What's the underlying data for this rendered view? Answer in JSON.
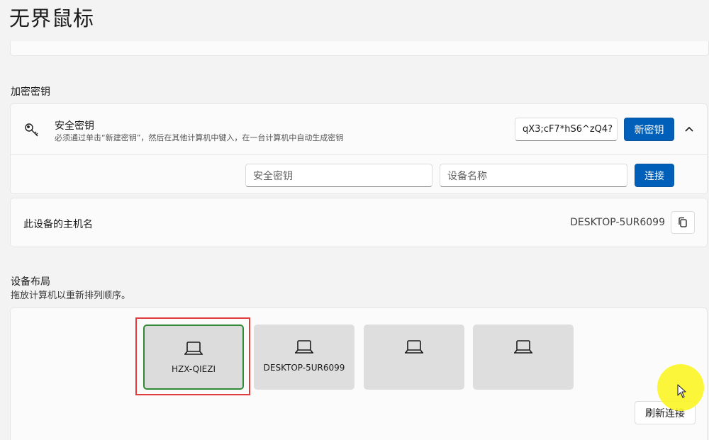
{
  "app": {
    "title": "无界鼠标"
  },
  "encryption": {
    "section_label": "加密密钥",
    "security_key_title": "安全密钥",
    "security_key_desc": "必须通过单击“新建密钥”，然后在其他计算机中键入，在一台计算机中自动生成密钥",
    "current_key": "qX3;cF7*hS6^zQ4?",
    "new_key_label": "新密钥",
    "key_input_placeholder": "安全密钥",
    "device_name_placeholder": "设备名称",
    "connect_label": "连接"
  },
  "host": {
    "label": "此设备的主机名",
    "value": "DESKTOP-5UR6099"
  },
  "layout": {
    "section_label": "设备布局",
    "hint": "拖放计算机以重新排列顺序。",
    "devices": [
      {
        "name": "HZX-QIEZI",
        "selected": true
      },
      {
        "name": "DESKTOP-5UR6099",
        "selected": false
      },
      {
        "name": "",
        "selected": false
      },
      {
        "name": "",
        "selected": false
      }
    ],
    "refresh_label": "刷新连接"
  },
  "icons": {
    "key": "key-icon",
    "chevron": "chevron-up-icon",
    "copy": "copy-icon",
    "computer": "laptop-icon",
    "cursor": "mouse-pointer-icon"
  },
  "colors": {
    "accent": "#005fb8",
    "selected_border": "#2f8a33",
    "highlight": "#e23b3b",
    "cursor_halo": "#faf51e"
  }
}
